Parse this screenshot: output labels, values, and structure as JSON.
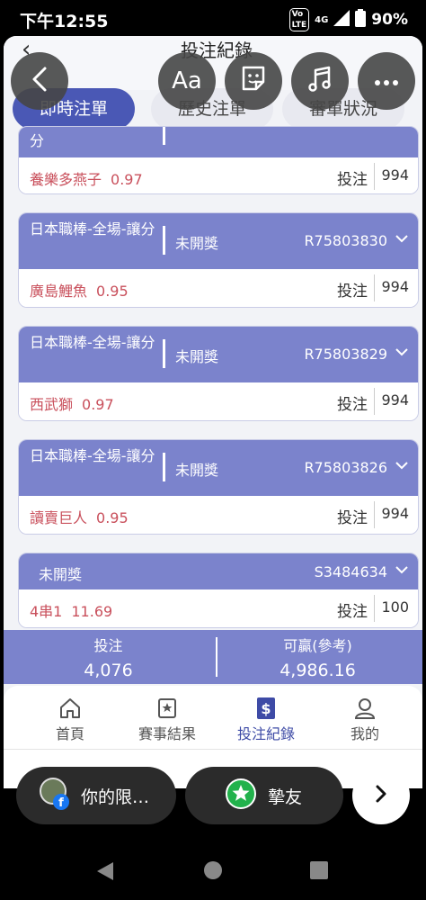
{
  "status_bar": {
    "time": "下午12:55",
    "volte": "Vo LTE",
    "network": "4G",
    "battery": "90%"
  },
  "header": {
    "title": "投注紀錄"
  },
  "tabs": [
    {
      "label": "即時注單",
      "active": true
    },
    {
      "label": "歷史注單",
      "active": false
    },
    {
      "label": "審單狀況",
      "active": false
    }
  ],
  "cards": [
    {
      "sport": "",
      "status": "",
      "code": "",
      "pick": "養樂多燕子",
      "odds": "0.97",
      "bet_label": "投注",
      "amount": "994"
    },
    {
      "sport": "日本職棒-全場-讓分",
      "status": "未開獎",
      "code": "R75803830",
      "pick": "廣島鯉魚",
      "odds": "0.95",
      "bet_label": "投注",
      "amount": "994"
    },
    {
      "sport": "日本職棒-全場-讓分",
      "status": "未開獎",
      "code": "R75803829",
      "pick": "西武獅",
      "odds": "0.97",
      "bet_label": "投注",
      "amount": "994"
    },
    {
      "sport": "日本職棒-全場-讓分",
      "status": "未開獎",
      "code": "R75803826",
      "pick": "讀賣巨人",
      "odds": "0.95",
      "bet_label": "投注",
      "amount": "994"
    },
    {
      "sport": "",
      "status": "未開獎",
      "code": "S3484634",
      "pick": "4串1",
      "odds": "11.69",
      "bet_label": "投注",
      "amount": "100"
    }
  ],
  "summary": {
    "bet_label": "投注",
    "bet_value": "4,076",
    "win_label": "可贏(參考)",
    "win_value": "4,986.16"
  },
  "bottom_nav": [
    {
      "label": "首頁",
      "icon": "home-icon",
      "active": false
    },
    {
      "label": "賽事結果",
      "icon": "results-icon",
      "active": false
    },
    {
      "label": "投注紀錄",
      "icon": "bet-record-icon",
      "active": true
    },
    {
      "label": "我的",
      "icon": "user-icon",
      "active": false
    }
  ],
  "overlay": {
    "buttons": [
      {
        "icon": "back-arrow-icon"
      },
      {
        "label": "Aa",
        "icon": "font-icon"
      },
      {
        "icon": "sticker-icon"
      },
      {
        "icon": "music-icon"
      },
      {
        "icon": "more-icon"
      }
    ],
    "chat_pill": {
      "label": "你的限…"
    },
    "friend_pill": {
      "label": "摯友"
    }
  },
  "colors": {
    "accent": "#4a58b5",
    "card_header": "#7b83cc",
    "pick_text": "#c9505c"
  }
}
